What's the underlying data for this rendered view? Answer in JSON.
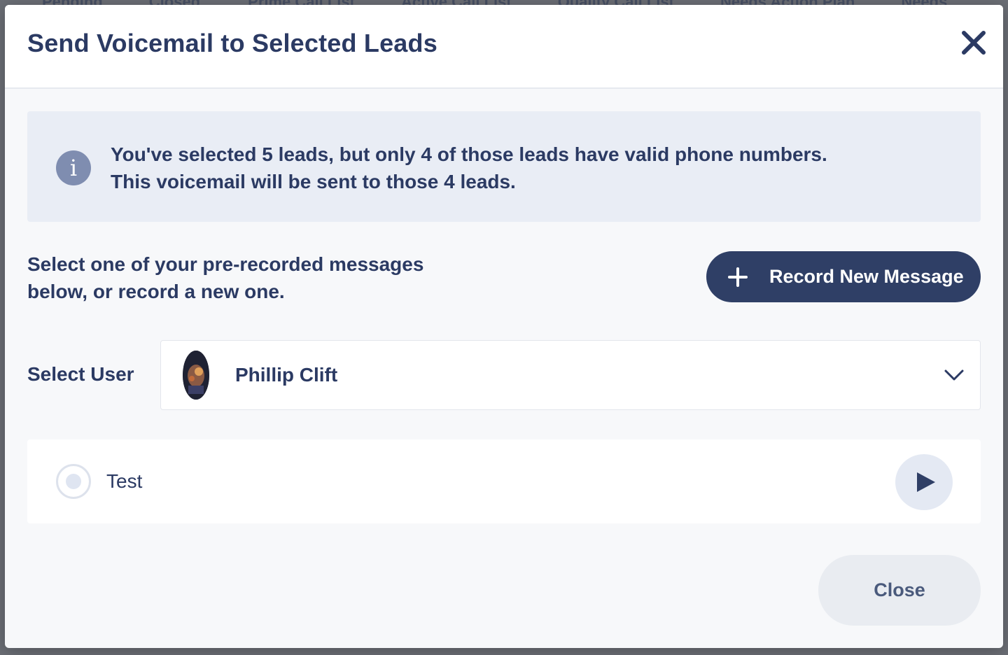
{
  "backdrop": {
    "tabs": [
      "Pending",
      "Closed",
      "Prime Call List",
      "Active Call List",
      "Quality Call List",
      "Needs Action Plan",
      "Needs"
    ]
  },
  "modal": {
    "title": "Send Voicemail to Selected Leads",
    "close_icon": "close-icon"
  },
  "info": {
    "icon": "info-icon",
    "line1": "You've selected 5 leads, but only 4 of those leads have valid phone numbers.",
    "line2": "This voicemail will be sent to those 4 leads."
  },
  "instructions": {
    "line1": "Select one of your pre-recorded messages",
    "line2": "below, or record a new one."
  },
  "record_button": {
    "label": "Record New Message",
    "icon": "plus-icon"
  },
  "user_select": {
    "label": "Select User",
    "selected": "Phillip Clift",
    "icon": "chevron-down-icon"
  },
  "messages": [
    {
      "label": "Test",
      "selected": false
    }
  ],
  "footer": {
    "close_label": "Close"
  },
  "colors": {
    "primary": "#2f3f66",
    "text": "#2b3a63",
    "info_bg": "#e9edf5",
    "info_icon": "#7f8db0"
  }
}
